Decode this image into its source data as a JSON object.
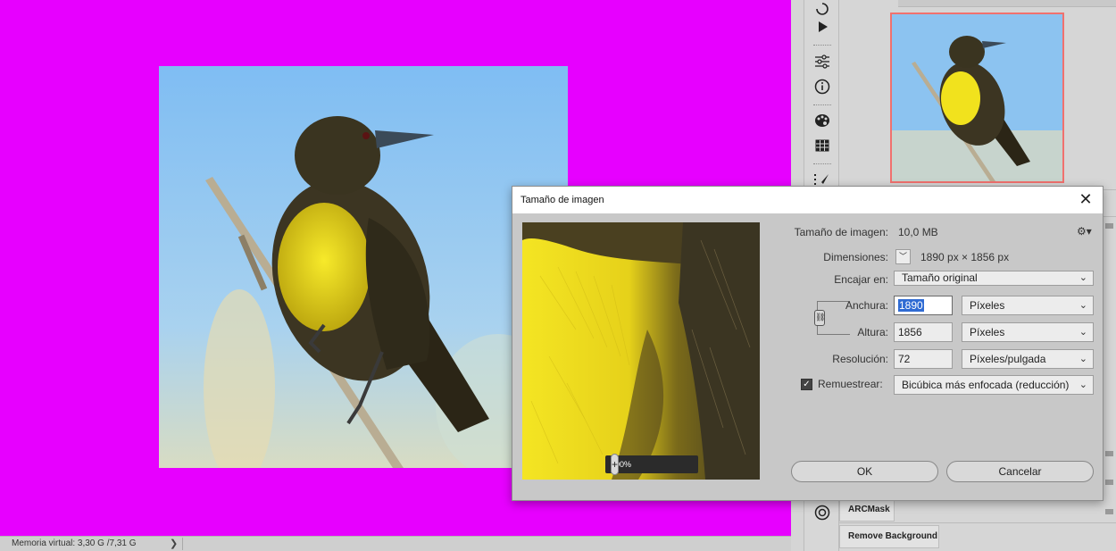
{
  "status_bar": {
    "memory_text": "Memoria virtual: 3,30 G /7,31 G",
    "arrow": "❯"
  },
  "panels": {
    "tabs": [
      "ARCMask",
      "Remove Background"
    ]
  },
  "toolbar": {
    "icons": [
      "history-icon",
      "play-icon",
      "adjustments-icon",
      "info-icon",
      "color-palette-icon",
      "grid-icon",
      "brush-presets-icon",
      "aperture-icon"
    ]
  },
  "dialog": {
    "title": "Tamaño de imagen",
    "close_label": "✕",
    "image_size_label": "Tamaño de imagen:",
    "image_size_value": "10,0 MB",
    "dimensions_label": "Dimensiones:",
    "dimensions_value": "1890 px × 1856 px",
    "fit_label": "Encajar en:",
    "fit_value": "Tamaño original",
    "width_label": "Anchura:",
    "width_value": "1890",
    "width_unit": "Píxeles",
    "height_label": "Altura:",
    "height_value": "1856",
    "height_unit": "Píxeles",
    "resolution_label": "Resolución:",
    "resolution_value": "72",
    "resolution_unit": "Píxeles/pulgada",
    "resample_label": "Remuestrear:",
    "resample_checked": true,
    "resample_value": "Bicúbica más enfocada (reducción)",
    "preview_zoom": "100%",
    "zoom_minus": "−",
    "zoom_plus": "+",
    "ok_label": "OK",
    "cancel_label": "Cancelar"
  },
  "colors": {
    "canvas_bg": "#e700ff",
    "sky": "#8cc3f0",
    "bird_yellow": "#f1e21d",
    "bird_dark": "#3a3420",
    "selection": "#2f6bd3",
    "thumb_border": "#f0716e"
  }
}
